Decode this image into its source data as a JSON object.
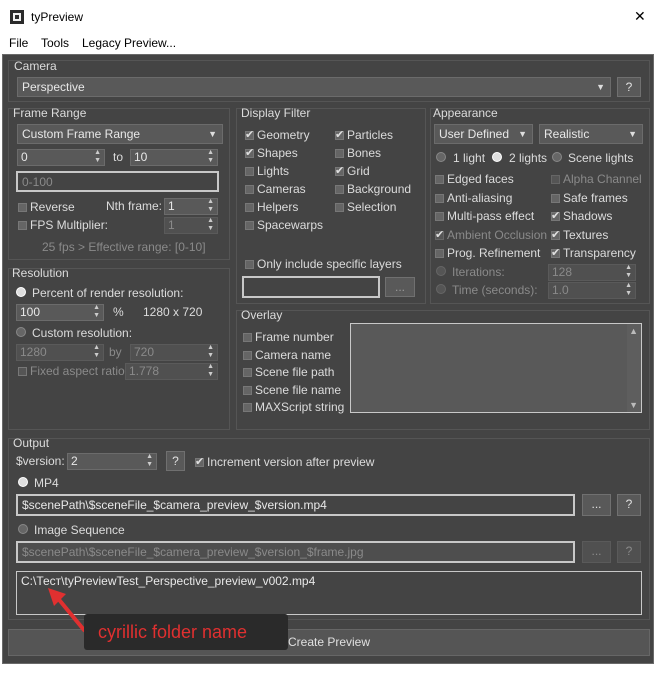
{
  "window": {
    "title": "tyPreview",
    "close_glyph": "✕"
  },
  "menu": [
    "File",
    "Tools",
    "Legacy Preview..."
  ],
  "camera": {
    "title": "Camera",
    "value": "Perspective",
    "help": "?"
  },
  "frame_range": {
    "title": "Frame Range",
    "mode": "Custom Frame Range",
    "from": "0",
    "to_label": "to",
    "to": "10",
    "range_placeholder": "0-100",
    "reverse": "Reverse",
    "nth_label": "Nth frame:",
    "nth": "1",
    "fps_label": "FPS Multiplier:",
    "fps": "1",
    "info": "25 fps > Effective range: [0-10]"
  },
  "resolution": {
    "title": "Resolution",
    "percent_label": "Percent of render resolution:",
    "percent": "100",
    "pct": "%",
    "dims": "1280 x 720",
    "custom_label": "Custom resolution:",
    "w": "1280",
    "by": "by",
    "h": "720",
    "aspect_label": "Fixed aspect ratio:",
    "aspect": "1.778"
  },
  "display_filter": {
    "title": "Display Filter",
    "left": [
      {
        "label": "Geometry",
        "checked": true
      },
      {
        "label": "Shapes",
        "checked": true
      },
      {
        "label": "Lights",
        "checked": false
      },
      {
        "label": "Cameras",
        "checked": false
      },
      {
        "label": "Helpers",
        "checked": false
      },
      {
        "label": "Spacewarps",
        "checked": false
      }
    ],
    "right": [
      {
        "label": "Particles",
        "checked": true
      },
      {
        "label": "Bones",
        "checked": false
      },
      {
        "label": "Grid",
        "checked": true
      },
      {
        "label": "Background",
        "checked": false
      },
      {
        "label": "Selection",
        "checked": false
      }
    ],
    "layers_label": "Only include specific layers",
    "layers_btn": "..."
  },
  "appearance": {
    "title": "Appearance",
    "mode": "User Defined",
    "style": "Realistic",
    "light1": "1 light",
    "light2": "2 lights",
    "scene_lights": "Scene lights",
    "left": [
      {
        "label": "Edged faces",
        "checked": false,
        "disabled": false
      },
      {
        "label": "Anti-aliasing",
        "checked": false,
        "disabled": false
      },
      {
        "label": "Multi-pass effect",
        "checked": false,
        "disabled": false
      },
      {
        "label": "Ambient Occlusion",
        "checked": true,
        "disabled": true
      },
      {
        "label": "Prog. Refinement",
        "checked": false,
        "disabled": false
      }
    ],
    "right": [
      {
        "label": "Alpha Channel",
        "checked": false,
        "disabled": true
      },
      {
        "label": "Safe frames",
        "checked": false,
        "disabled": false
      },
      {
        "label": "Shadows",
        "checked": true,
        "disabled": false
      },
      {
        "label": "Textures",
        "checked": true,
        "disabled": false
      },
      {
        "label": "Transparency",
        "checked": true,
        "disabled": false
      }
    ],
    "iterations_label": "Iterations:",
    "iterations": "128",
    "time_label": "Time (seconds):",
    "time": "1.0"
  },
  "overlay": {
    "title": "Overlay",
    "items": [
      "Frame number",
      "Camera name",
      "Scene file path",
      "Scene file name",
      "MAXScript string"
    ]
  },
  "output": {
    "title": "Output",
    "version_label": "$version:",
    "version": "2",
    "help": "?",
    "increment_label": "Increment version after preview",
    "mp4_label": "MP4",
    "mp4_path": "$scenePath\\$sceneFile_$camera_preview_$version.mp4",
    "imgseq_label": "Image Sequence",
    "imgseq_path": "$scenePath\\$sceneFile_$camera_preview_$version_$frame.jpg",
    "btn_dots": "...",
    "result": "C:\\Тест\\tyPreviewTest_Perspective_preview_v002.mp4"
  },
  "annotation": {
    "text": "cyrillic folder name",
    "color": "#e03030"
  },
  "create_button": "Create Preview"
}
